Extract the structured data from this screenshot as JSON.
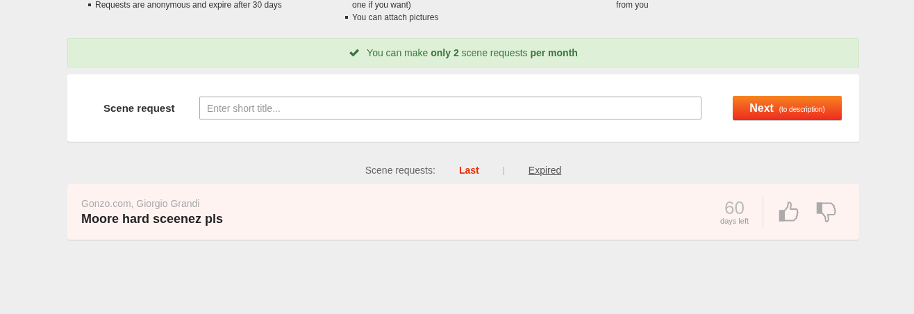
{
  "info_columns": [
    {
      "lines": [
        {
          "text": "Requests are anonymous and expire after 30 days",
          "bullet": true
        }
      ]
    },
    {
      "lines": [
        {
          "text": "one if you want)",
          "bullet": false
        },
        {
          "text": "You can attach pictures",
          "bullet": true
        }
      ]
    },
    {
      "lines": [
        {
          "text": "from you",
          "bullet": false
        }
      ]
    }
  ],
  "notice": {
    "text": "You can make **only 2** scene requests **per month**"
  },
  "request_form": {
    "label": "Scene request",
    "placeholder": "Enter short title...",
    "button": {
      "label": "Next",
      "hint": "(to description)"
    }
  },
  "list_tabs": {
    "label": "Scene requests:",
    "separator": "|",
    "tabs": [
      {
        "label": "Last",
        "selected": true
      },
      {
        "label": "Expired",
        "selected": false
      }
    ]
  },
  "requests": [
    {
      "source": "Gonzo.com, Giorgio Grandi",
      "title": "Moore hard sceenez pls",
      "days": "60",
      "days_label": "days left"
    }
  ]
}
